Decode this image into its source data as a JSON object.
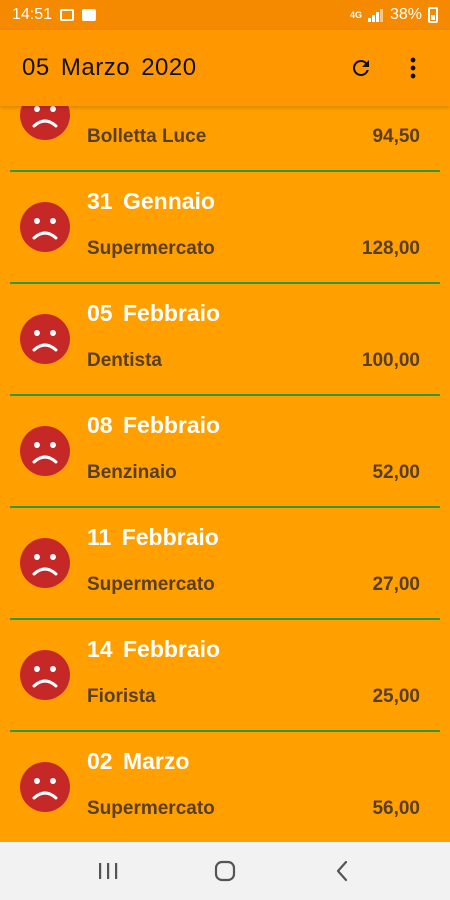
{
  "status_bar": {
    "time": "14:51",
    "network": "4G",
    "battery": "38%"
  },
  "app_bar": {
    "title": "05  Marzo  2020"
  },
  "colors": {
    "background": "#FFA000",
    "app_bar": "#FF9800",
    "status_bar": "#F58A00",
    "divider": "#2E9A3A",
    "sad_face": "#C62828",
    "label_text": "#5A3E1E"
  },
  "entries": [
    {
      "date": "",
      "description": "Bolletta Luce",
      "amount": "94,50",
      "icon": "sad-face-icon"
    },
    {
      "date": "31  Gennaio",
      "description": "Supermercato",
      "amount": "128,00",
      "icon": "sad-face-icon"
    },
    {
      "date": "05  Febbraio",
      "description": "Dentista",
      "amount": "100,00",
      "icon": "sad-face-icon"
    },
    {
      "date": "08  Febbraio",
      "description": "Benzinaio",
      "amount": "52,00",
      "icon": "sad-face-icon"
    },
    {
      "date": "11  Febbraio",
      "description": "Supermercato",
      "amount": "27,00",
      "icon": "sad-face-icon"
    },
    {
      "date": "14  Febbraio",
      "description": "Fiorista",
      "amount": "25,00",
      "icon": "sad-face-icon"
    },
    {
      "date": "02  Marzo",
      "description": "Supermercato",
      "amount": "56,00",
      "icon": "sad-face-icon"
    }
  ]
}
